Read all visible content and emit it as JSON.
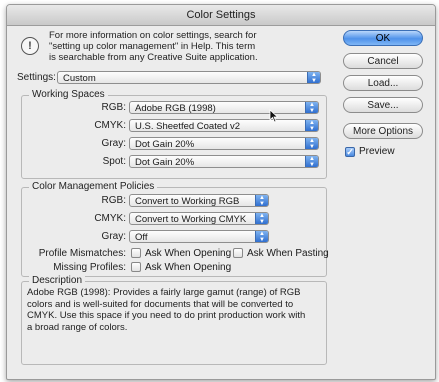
{
  "window": {
    "title": "Color Settings"
  },
  "info": {
    "icon": "info-icon",
    "line1": "For more information on color settings, search for",
    "line2": "\"setting up color management\" in Help. This term",
    "line3": "is searchable from any Creative Suite application."
  },
  "settings": {
    "label": "Settings:",
    "value": "Custom"
  },
  "working_spaces": {
    "title": "Working Spaces",
    "rows": [
      {
        "label": "RGB:",
        "value": "Adobe RGB (1998)"
      },
      {
        "label": "CMYK:",
        "value": "U.S. Sheetfed Coated v2"
      },
      {
        "label": "Gray:",
        "value": "Dot Gain 20%"
      },
      {
        "label": "Spot:",
        "value": "Dot Gain 20%"
      }
    ]
  },
  "policies": {
    "title": "Color Management Policies",
    "rows": [
      {
        "label": "RGB:",
        "value": "Convert to Working RGB"
      },
      {
        "label": "CMYK:",
        "value": "Convert to Working CMYK"
      },
      {
        "label": "Gray:",
        "value": "Off"
      }
    ],
    "mismatch_label": "Profile Mismatches:",
    "ask_opening": "Ask When Opening",
    "ask_pasting": "Ask When Pasting",
    "missing_label": "Missing Profiles:",
    "missing_ask_opening": "Ask When Opening"
  },
  "description": {
    "title": "Description",
    "line1": "Adobe RGB (1998): Provides a fairly large gamut (range) of RGB",
    "line2": "colors and is well-suited for documents that will be converted to",
    "line3": "CMYK. Use this space if you need to do print production work with",
    "line4": "a broad range of colors."
  },
  "buttons": {
    "ok": "OK",
    "cancel": "Cancel",
    "load": "Load...",
    "save": "Save...",
    "more_options": "More Options"
  },
  "preview": {
    "label": "Preview",
    "checked": true
  },
  "colors": {
    "accent": "#4f92ea",
    "window_bg": "#ececec"
  }
}
